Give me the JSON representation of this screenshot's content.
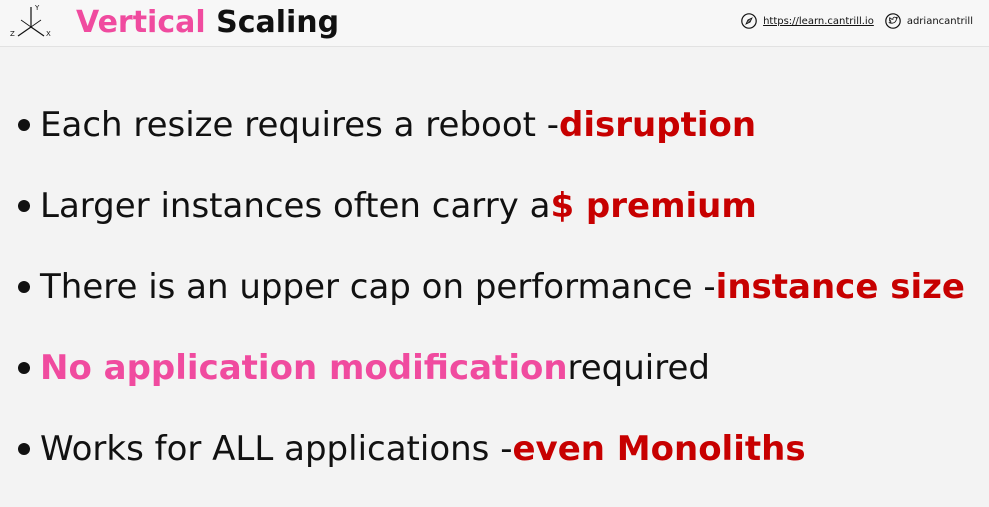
{
  "header": {
    "title_accent": "Vertical",
    "title_rest": "Scaling",
    "logo_axes": {
      "y": "Y",
      "z": "Z",
      "x": "X"
    },
    "site_link": "https://learn.cantrill.io",
    "twitter_handle": "adriancantrill"
  },
  "bullets": [
    {
      "lead": "Each resize requires a reboot - ",
      "emphasis": "disruption",
      "tail": ""
    },
    {
      "lead": "Larger instances often carry a ",
      "emphasis": "$ premium",
      "tail": ""
    },
    {
      "lead": "There is an upper cap on performance - ",
      "emphasis": "instance size",
      "tail": ""
    },
    {
      "lead": "",
      "emphasis": "No application modification",
      "tail": " required"
    },
    {
      "lead": "Works for ALL applications - ",
      "emphasis": "even Monoliths",
      "tail": ""
    }
  ],
  "colors": {
    "accent_pink": "#f04b9f",
    "emphasis_red": "#c70000",
    "text": "#111111"
  },
  "icons": [
    "axis-icon",
    "compass-icon",
    "twitter-icon"
  ]
}
